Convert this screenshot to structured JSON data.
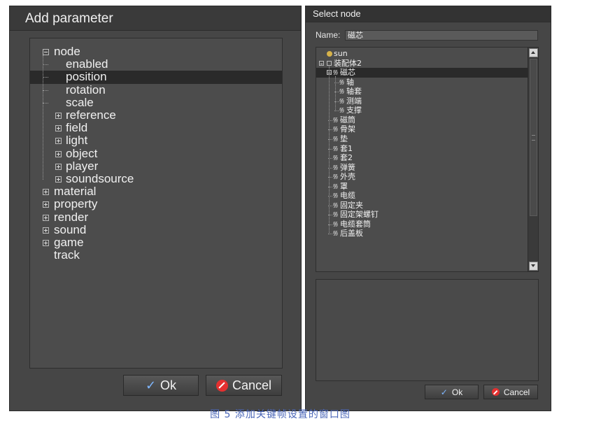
{
  "left_dialog": {
    "title": "Add parameter",
    "tree": [
      {
        "label": "node",
        "level": 0,
        "expander": "minus"
      },
      {
        "label": "enabled",
        "level": 1
      },
      {
        "label": "position",
        "level": 1,
        "selected": true
      },
      {
        "label": "rotation",
        "level": 1
      },
      {
        "label": "scale",
        "level": 1
      },
      {
        "label": "reference",
        "level": 1,
        "expander": "plus"
      },
      {
        "label": "field",
        "level": 1,
        "expander": "plus"
      },
      {
        "label": "light",
        "level": 1,
        "expander": "plus"
      },
      {
        "label": "object",
        "level": 1,
        "expander": "plus"
      },
      {
        "label": "player",
        "level": 1,
        "expander": "plus"
      },
      {
        "label": "soundsource",
        "level": 1,
        "expander": "plus"
      },
      {
        "label": "material",
        "level": 0,
        "expander": "plus"
      },
      {
        "label": "property",
        "level": 0,
        "expander": "plus"
      },
      {
        "label": "render",
        "level": 0,
        "expander": "plus"
      },
      {
        "label": "sound",
        "level": 0,
        "expander": "plus"
      },
      {
        "label": "game",
        "level": 0,
        "expander": "plus"
      },
      {
        "label": "track",
        "level": 0
      }
    ],
    "ok_label": "Ok",
    "cancel_label": "Cancel"
  },
  "right_dialog": {
    "title": "Select node",
    "name_label": "Name:",
    "name_value": "磁芯",
    "tree": [
      {
        "label": "sun",
        "level": 0,
        "icon": "sun-icon"
      },
      {
        "label": "装配体2",
        "level": 0,
        "expander": "minus",
        "icon": "assembly-icon"
      },
      {
        "label": "磁芯",
        "level": 1,
        "expander": "minus",
        "icon": "node-icon",
        "selected": true
      },
      {
        "label": "轴",
        "level": 2,
        "icon": "node-icon"
      },
      {
        "label": "轴套",
        "level": 2,
        "icon": "node-icon"
      },
      {
        "label": "测端",
        "level": 2,
        "icon": "node-icon"
      },
      {
        "label": "支撑",
        "level": 2,
        "icon": "node-icon"
      },
      {
        "label": "磁筒",
        "level": 1,
        "icon": "node-icon"
      },
      {
        "label": "骨架",
        "level": 1,
        "icon": "node-icon"
      },
      {
        "label": "垫",
        "level": 1,
        "icon": "node-icon"
      },
      {
        "label": "套1",
        "level": 1,
        "icon": "node-icon"
      },
      {
        "label": "套2",
        "level": 1,
        "icon": "node-icon"
      },
      {
        "label": "弹簧",
        "level": 1,
        "icon": "node-icon"
      },
      {
        "label": "外壳",
        "level": 1,
        "icon": "node-icon"
      },
      {
        "label": "罩",
        "level": 1,
        "icon": "node-icon"
      },
      {
        "label": "电缆",
        "level": 1,
        "icon": "node-icon"
      },
      {
        "label": "固定夹",
        "level": 1,
        "icon": "node-icon"
      },
      {
        "label": "固定架螺钉",
        "level": 1,
        "icon": "node-icon"
      },
      {
        "label": "电缆套筒",
        "level": 1,
        "icon": "node-icon"
      },
      {
        "label": "后盖板",
        "level": 1,
        "icon": "node-icon"
      }
    ],
    "ok_label": "Ok",
    "cancel_label": "Cancel"
  },
  "caption": "图 5 添加关键帧设置的窗口图"
}
